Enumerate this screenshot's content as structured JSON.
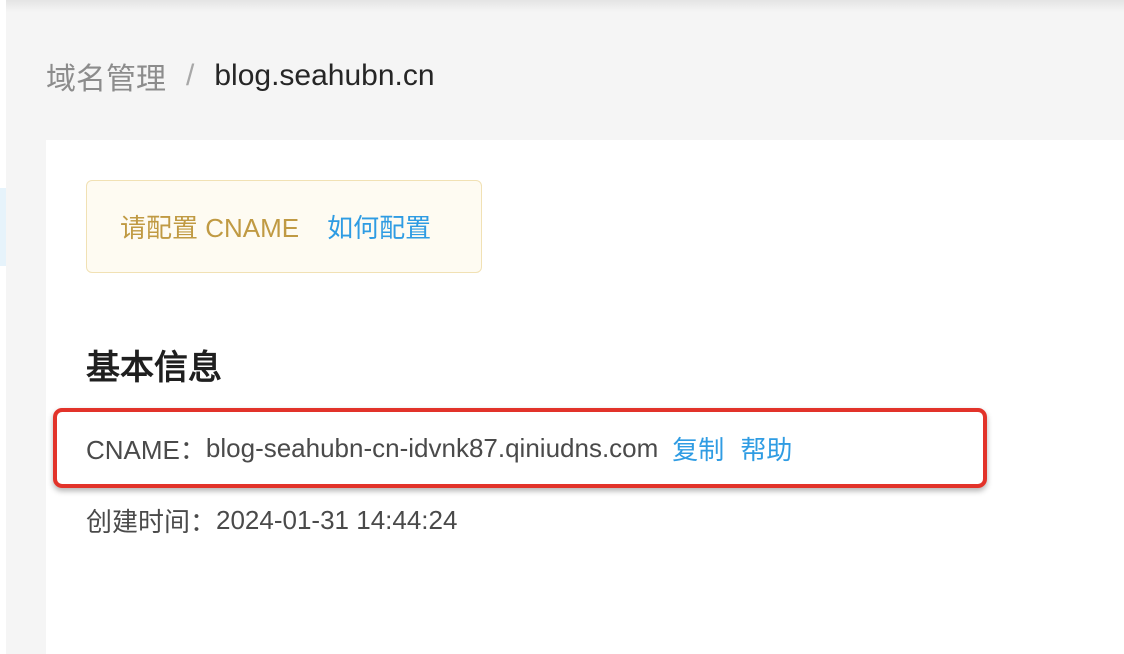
{
  "breadcrumb": {
    "parent": "域名管理",
    "separator": "/",
    "current": "blog.seahubn.cn"
  },
  "alert": {
    "message": "请配置 CNAME",
    "link": "如何配置"
  },
  "basic_info": {
    "title": "基本信息",
    "cname_label": "CNAME：",
    "cname_value": "blog-seahubn-cn-idvnk87.qiniudns.com",
    "copy_label": "复制",
    "help_label": "帮助",
    "created_label": "创建时间：",
    "created_value": "2024-01-31 14:44:24"
  },
  "colors": {
    "alert_text": "#c09a43",
    "link": "#2f9ce3",
    "highlight_border": "#e2332a"
  }
}
